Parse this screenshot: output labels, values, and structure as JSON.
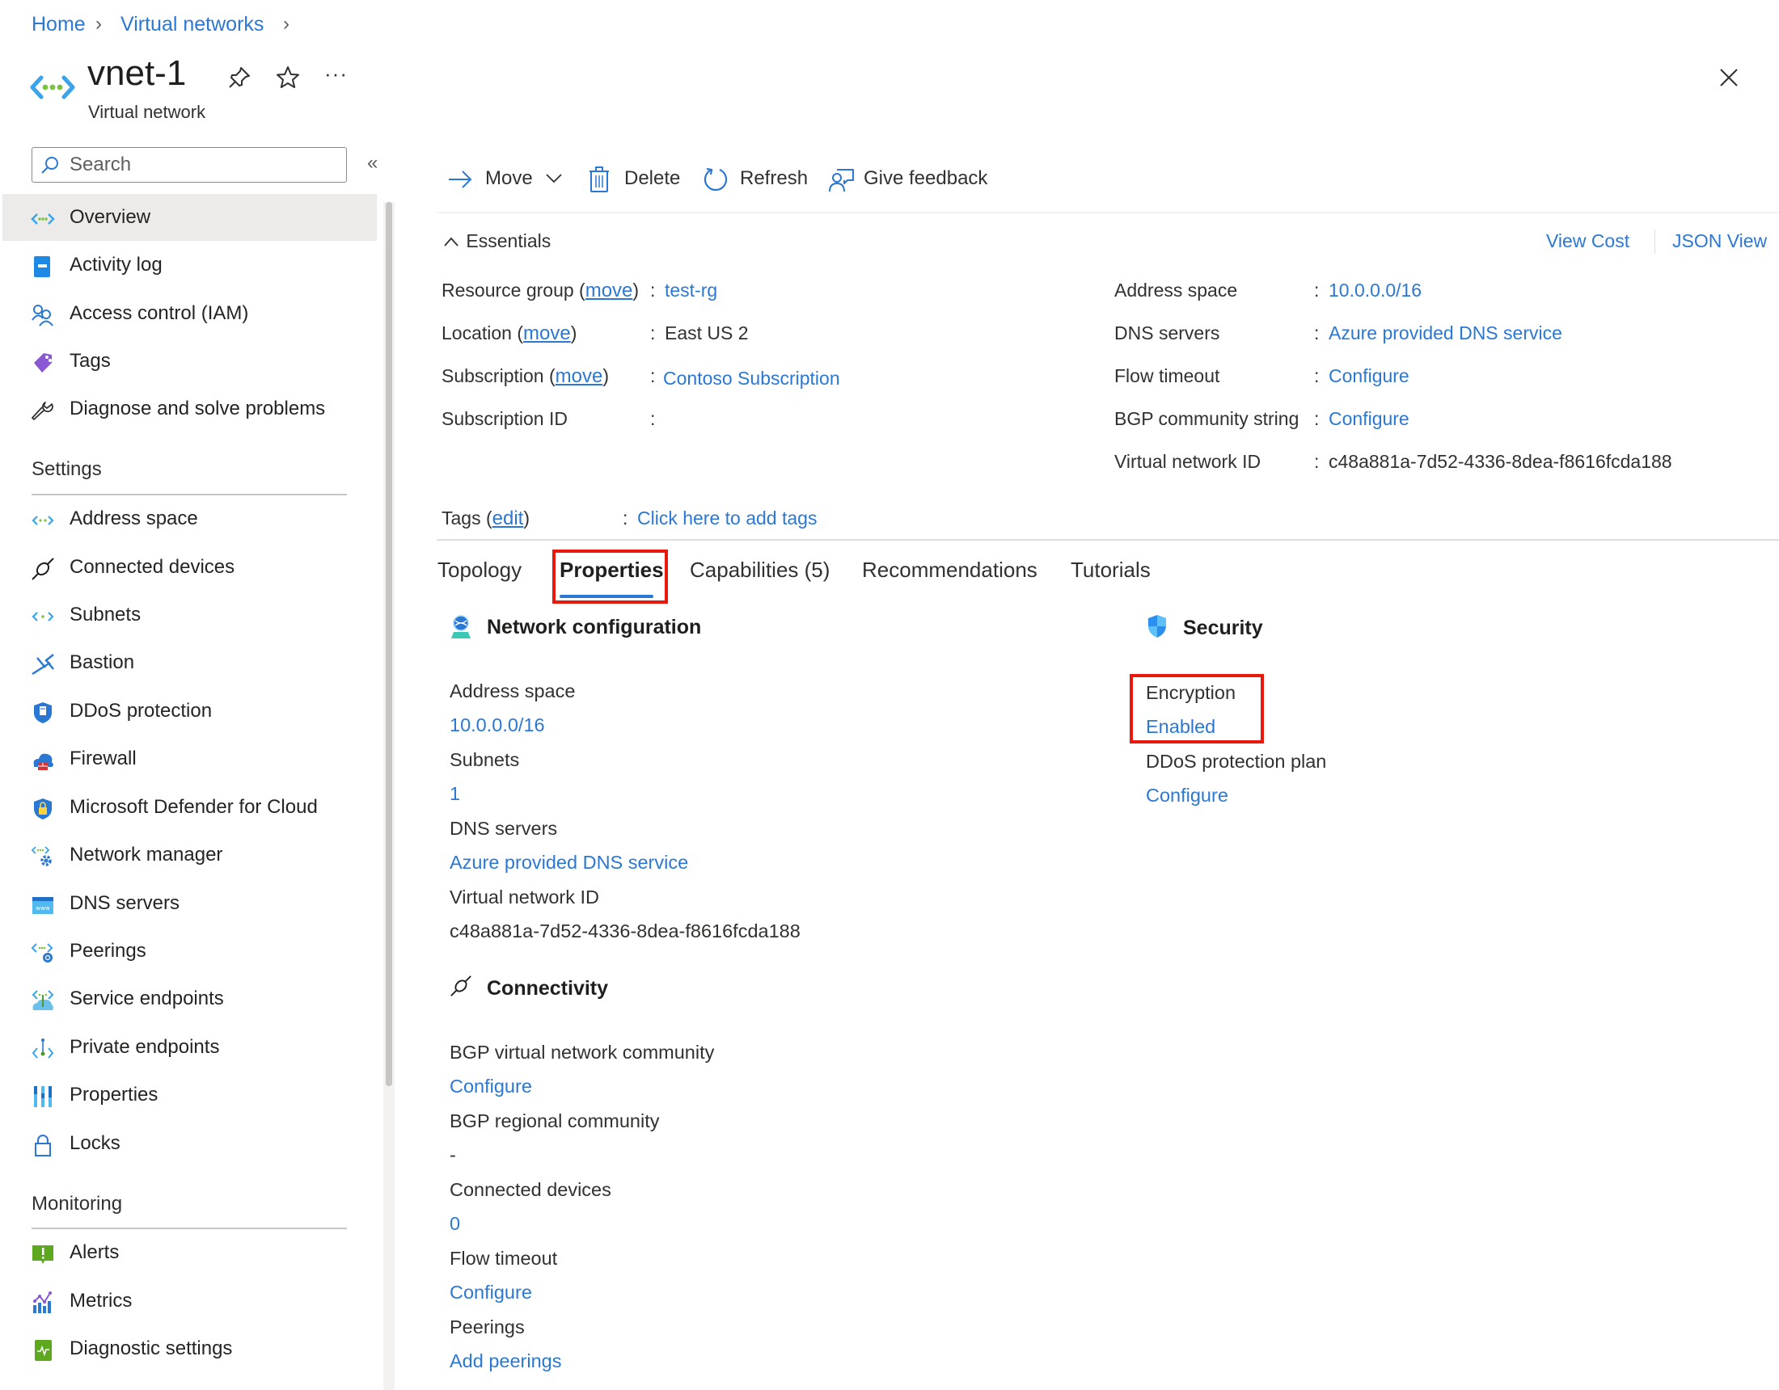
{
  "breadcrumb": [
    {
      "label": "Home"
    },
    {
      "label": "Virtual networks"
    }
  ],
  "header": {
    "title": "vnet-1",
    "subtitle": "Virtual network",
    "pin_icon": "pin-icon",
    "favorite_icon": "star-icon",
    "more_icon": "ellipsis-icon",
    "close_icon": "close-icon"
  },
  "sidebar": {
    "search_placeholder": "Search",
    "collapse_icon": "double-chevron-left-icon",
    "top_items": [
      {
        "label": "Overview",
        "icon": "virtual-network-icon",
        "selected": true
      },
      {
        "label": "Activity log",
        "icon": "activity-log-icon"
      },
      {
        "label": "Access control (IAM)",
        "icon": "people-icon"
      },
      {
        "label": "Tags",
        "icon": "tag-icon"
      },
      {
        "label": "Diagnose and solve problems",
        "icon": "wrench-icon"
      }
    ],
    "groups": [
      {
        "header": "Settings",
        "items": [
          {
            "label": "Address space",
            "icon": "virtual-network-icon"
          },
          {
            "label": "Connected devices",
            "icon": "plug-icon"
          },
          {
            "label": "Subnets",
            "icon": "subnet-icon"
          },
          {
            "label": "Bastion",
            "icon": "bastion-icon"
          },
          {
            "label": "DDoS protection",
            "icon": "ddos-shield-icon"
          },
          {
            "label": "Firewall",
            "icon": "firewall-icon"
          },
          {
            "label": "Microsoft Defender for Cloud",
            "icon": "defender-shield-icon"
          },
          {
            "label": "Network manager",
            "icon": "network-manager-icon"
          },
          {
            "label": "DNS servers",
            "icon": "dns-icon"
          },
          {
            "label": "Peerings",
            "icon": "peerings-icon"
          },
          {
            "label": "Service endpoints",
            "icon": "service-endpoints-icon"
          },
          {
            "label": "Private endpoints",
            "icon": "private-endpoints-icon"
          },
          {
            "label": "Properties",
            "icon": "properties-icon"
          },
          {
            "label": "Locks",
            "icon": "lock-icon"
          }
        ]
      },
      {
        "header": "Monitoring",
        "items": [
          {
            "label": "Alerts",
            "icon": "alerts-icon"
          },
          {
            "label": "Metrics",
            "icon": "metrics-icon"
          },
          {
            "label": "Diagnostic settings",
            "icon": "diagnostic-settings-icon"
          }
        ]
      }
    ]
  },
  "toolbar": {
    "move": "Move",
    "delete": "Delete",
    "refresh": "Refresh",
    "feedback": "Give feedback"
  },
  "essentials": {
    "header": "Essentials",
    "view_cost": "View Cost",
    "json_view": "JSON View",
    "left": [
      {
        "label": "Resource group",
        "action": "move",
        "value": "test-rg",
        "value_is_link": true
      },
      {
        "label": "Location",
        "action": "move",
        "value": "East US 2",
        "value_is_link": false
      },
      {
        "label": "Subscription",
        "action": "move",
        "value": "Contoso Subscription",
        "value_is_link": true
      },
      {
        "label": "Subscription ID",
        "action": "",
        "value": "",
        "value_is_link": false
      }
    ],
    "right": [
      {
        "label": "Address space",
        "value": "10.0.0.0/16",
        "value_is_link": true
      },
      {
        "label": "DNS servers",
        "value": "Azure provided DNS service",
        "value_is_link": true
      },
      {
        "label": "Flow timeout",
        "value": "Configure",
        "value_is_link": true
      },
      {
        "label": "BGP community string",
        "value": "Configure",
        "value_is_link": true
      },
      {
        "label": "Virtual network ID",
        "value": "c48a881a-7d52-4336-8dea-f8616fcda188",
        "value_is_link": false
      }
    ],
    "tags": {
      "label": "Tags",
      "action": "edit",
      "value": "Click here to add tags"
    },
    "colon": ":"
  },
  "tabs": [
    {
      "label": "Topology"
    },
    {
      "label": "Properties",
      "selected": true
    },
    {
      "label": "Capabilities (5)"
    },
    {
      "label": "Recommendations"
    },
    {
      "label": "Tutorials"
    }
  ],
  "properties": {
    "network_configuration": {
      "title": "Network configuration",
      "items": [
        {
          "label": "Address space",
          "value": "10.0.0.0/16",
          "link": true
        },
        {
          "label": "Subnets",
          "value": "1",
          "link": true
        },
        {
          "label": "DNS servers",
          "value": "Azure provided DNS service",
          "link": true
        },
        {
          "label": "Virtual network ID",
          "value": "c48a881a-7d52-4336-8dea-f8616fcda188",
          "link": false
        }
      ]
    },
    "connectivity": {
      "title": "Connectivity",
      "items": [
        {
          "label": "BGP virtual network community",
          "value": "Configure",
          "link": true
        },
        {
          "label": "BGP regional community",
          "value": "-",
          "link": false
        },
        {
          "label": "Connected devices",
          "value": "0",
          "link": true
        },
        {
          "label": "Flow timeout",
          "value": "Configure",
          "link": true
        },
        {
          "label": "Peerings",
          "value": "Add peerings",
          "link": true
        }
      ]
    },
    "security": {
      "title": "Security",
      "items": [
        {
          "label": "Encryption",
          "value": "Enabled",
          "link": true
        },
        {
          "label": "DDoS protection plan",
          "value": "Configure",
          "link": true
        }
      ]
    }
  },
  "colors": {
    "link": "#2b78d4",
    "highlight_box": "#e8180c",
    "selected_nav_bg": "#edebe9"
  }
}
